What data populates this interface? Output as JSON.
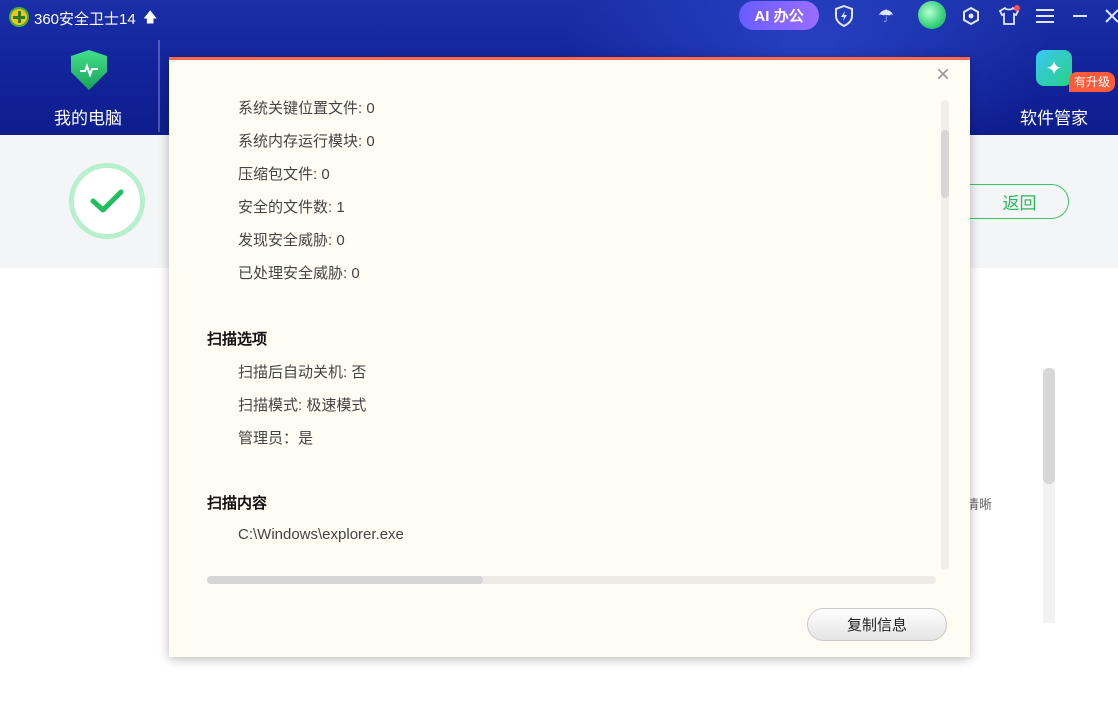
{
  "app": {
    "title": "360安全卫士14",
    "ai_button": "AI 办公"
  },
  "nav": {
    "my_pc": "我的电脑",
    "software_manager": "软件管家",
    "upgrade_badge": "有升级"
  },
  "background": {
    "back_button": "返回",
    "partial_text": "清晰"
  },
  "dialog": {
    "stats": [
      {
        "label": "系统关键位置文件",
        "value": "0"
      },
      {
        "label": "系统内存运行模块",
        "value": "0"
      },
      {
        "label": "压缩包文件",
        "value": "0"
      },
      {
        "label": "安全的文件数",
        "value": "1"
      },
      {
        "label": "发现安全威胁",
        "value": "0"
      },
      {
        "label": "已处理安全威胁",
        "value": "0"
      }
    ],
    "stat_lines": [
      "系统关键位置文件: 0",
      "系统内存运行模块: 0",
      "压缩包文件: 0",
      "安全的文件数: 1",
      "发现安全威胁: 0",
      "已处理安全威胁: 0"
    ],
    "scan_options_title": "扫描选项",
    "scan_options": [
      "扫描后自动关机: 否",
      "扫描模式: 极速模式",
      "管理员：是"
    ],
    "scan_content_title": "扫描内容",
    "scan_content": [
      "C:\\Windows\\explorer.exe"
    ],
    "copy_button": "复制信息"
  },
  "colors": {
    "header_blue": "#12239a",
    "accent_green": "#2cb85c",
    "dialog_bg": "#fffcf3",
    "dialog_top_border": "#ff6b4a"
  },
  "icons": {
    "close": "close-icon",
    "shield": "shield-icon",
    "check": "check-icon"
  }
}
